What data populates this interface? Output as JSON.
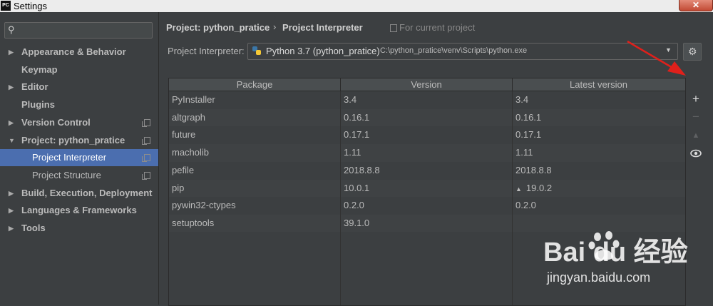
{
  "window": {
    "title": "Settings",
    "logo": "PC",
    "close": "✕"
  },
  "sidebar": {
    "search_placeholder": "",
    "items": [
      {
        "label": "Appearance & Behavior",
        "arrow": "▶",
        "bold": true
      },
      {
        "label": "Keymap",
        "bold": true
      },
      {
        "label": "Editor",
        "arrow": "▶",
        "bold": true
      },
      {
        "label": "Plugins",
        "bold": true
      },
      {
        "label": "Version Control",
        "arrow": "▶",
        "bold": true,
        "copy": true
      },
      {
        "label": "Project: python_pratice",
        "arrow": "▼",
        "bold": true,
        "copy": true
      },
      {
        "label": "Project Interpreter",
        "selected": true,
        "copy": true
      },
      {
        "label": "Project Structure",
        "copy": true
      },
      {
        "label": "Build, Execution, Deployment",
        "arrow": "▶",
        "bold": true
      },
      {
        "label": "Languages & Frameworks",
        "arrow": "▶",
        "bold": true
      },
      {
        "label": "Tools",
        "arrow": "▶",
        "bold": true
      }
    ]
  },
  "breadcrumb": {
    "project": "Project: python_pratice",
    "separator": "›",
    "page": "Project Interpreter",
    "scope": "For current project"
  },
  "interpreter": {
    "label": "Project Interpreter:",
    "name": "Python 3.7 (python_pratice)",
    "path": "C:\\python_pratice\\venv\\Scripts\\python.exe"
  },
  "table": {
    "headers": [
      "Package",
      "Version",
      "Latest version"
    ],
    "rows": [
      {
        "package": "PyInstaller",
        "version": "3.4",
        "latest": "3.4"
      },
      {
        "package": "altgraph",
        "version": "0.16.1",
        "latest": "0.16.1"
      },
      {
        "package": "future",
        "version": "0.17.1",
        "latest": "0.17.1"
      },
      {
        "package": "macholib",
        "version": "1.11",
        "latest": "1.11"
      },
      {
        "package": "pefile",
        "version": "2018.8.8",
        "latest": "2018.8.8"
      },
      {
        "package": "pip",
        "version": "10.0.1",
        "latest": "19.0.2",
        "upgrade": true
      },
      {
        "package": "pywin32-ctypes",
        "version": "0.2.0",
        "latest": "0.2.0"
      },
      {
        "package": "setuptools",
        "version": "39.1.0",
        "latest": ""
      }
    ]
  },
  "tools": {
    "add": "+",
    "remove": "−",
    "upgrade": "▲",
    "show": "eye-icon"
  },
  "watermark": {
    "main": "Bai du 经验",
    "sub": "jingyan.baidu.com"
  },
  "colors": {
    "selection": "#4b6eaf",
    "arrow": "#e0201b"
  }
}
